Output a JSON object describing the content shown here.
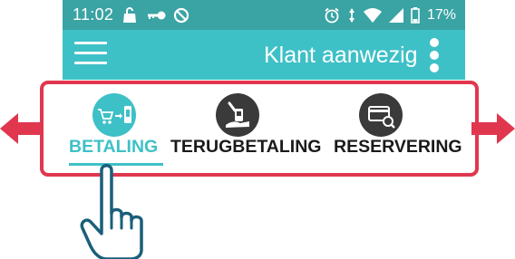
{
  "status_bar": {
    "time": "11:02",
    "battery": "17%",
    "left_icons": [
      "bag-icon",
      "key-icon",
      "no-signal-icon"
    ],
    "right_icons": [
      "alarm-icon",
      "data-icon",
      "wifi-icon",
      "signal-icon",
      "battery-icon"
    ]
  },
  "app_bar": {
    "title": "Klant aanwezig",
    "menu_icon": "hamburger-menu-icon",
    "overflow_icon": "more-vertical-icon"
  },
  "tabs": [
    {
      "label": "BETALING",
      "icon": "cart-to-phone-icon",
      "active": true
    },
    {
      "label": "TERUGBETALING",
      "icon": "refund-hand-icon",
      "active": false
    },
    {
      "label": "RESERVERING",
      "icon": "card-search-icon",
      "active": false
    }
  ],
  "colors": {
    "status_bar": "#3aa3a4",
    "app_bar": "#3ec0c7",
    "accent": "#3ec0c7",
    "highlight_border": "#e0374f",
    "arrows": "#e0374f",
    "inactive_icon": "#3a3a3a"
  },
  "annotations": {
    "left_arrow_icon": "arrow-left-icon",
    "right_arrow_icon": "arrow-right-icon",
    "gesture_icon": "pointing-hand-icon"
  }
}
